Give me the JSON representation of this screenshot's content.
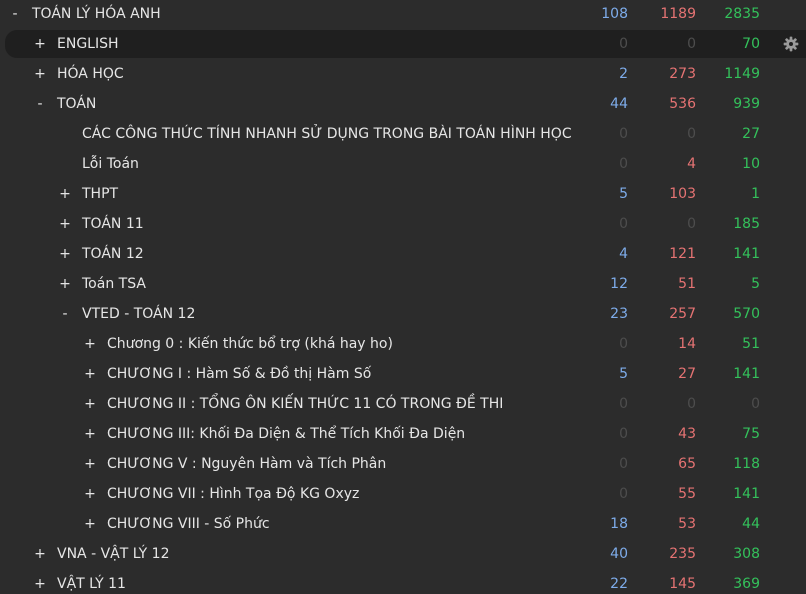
{
  "rows": [
    {
      "toggle": "-",
      "name": "TOÁN LÝ HÓA ANH",
      "new": "108",
      "learn": "1189",
      "due": "2835"
    },
    {
      "toggle": "+",
      "name": "ENGLISH",
      "new": "0",
      "learn": "0",
      "due": "70"
    },
    {
      "toggle": "+",
      "name": "HÓA HỌC",
      "new": "2",
      "learn": "273",
      "due": "1149"
    },
    {
      "toggle": "-",
      "name": "TOÁN",
      "new": "44",
      "learn": "536",
      "due": "939"
    },
    {
      "toggle": "",
      "name": "CÁC CÔNG THỨC TÍNH NHANH SỬ DỤNG TRONG BÀI TOÁN HÌNH HỌC",
      "new": "0",
      "learn": "0",
      "due": "27"
    },
    {
      "toggle": "",
      "name": "Lỗi Toán",
      "new": "0",
      "learn": "4",
      "due": "10"
    },
    {
      "toggle": "+",
      "name": "THPT",
      "new": "5",
      "learn": "103",
      "due": "1"
    },
    {
      "toggle": "+",
      "name": "TOÁN 11",
      "new": "0",
      "learn": "0",
      "due": "185"
    },
    {
      "toggle": "+",
      "name": "TOÁN 12",
      "new": "4",
      "learn": "121",
      "due": "141"
    },
    {
      "toggle": "+",
      "name": "Toán TSA",
      "new": "12",
      "learn": "51",
      "due": "5"
    },
    {
      "toggle": "-",
      "name": "VTED - TOÁN 12",
      "new": "23",
      "learn": "257",
      "due": "570"
    },
    {
      "toggle": "+",
      "name": "Chương 0 : Kiến thức bổ trợ (khá hay ho)",
      "new": "0",
      "learn": "14",
      "due": "51"
    },
    {
      "toggle": "+",
      "name": "CHƯƠNG I : Hàm Số & Đồ thị Hàm Số",
      "new": "5",
      "learn": "27",
      "due": "141"
    },
    {
      "toggle": "+",
      "name": "CHƯƠNG II : TỔNG ÔN KIẾN THỨC 11 CÓ TRONG ĐỀ THI",
      "new": "0",
      "learn": "0",
      "due": "0"
    },
    {
      "toggle": "+",
      "name": "CHƯƠNG III: Khối Đa Diện & Thể Tích Khối Đa Diện",
      "new": "0",
      "learn": "43",
      "due": "75"
    },
    {
      "toggle": "+",
      "name": "CHƯƠNG V : Nguyên Hàm và Tích Phân",
      "new": "0",
      "learn": "65",
      "due": "118"
    },
    {
      "toggle": "+",
      "name": "CHƯƠNG VII : Hình Tọa Độ KG Oxyz",
      "new": "0",
      "learn": "55",
      "due": "141"
    },
    {
      "toggle": "+",
      "name": "CHƯƠNG VIII - Số Phức",
      "new": "18",
      "learn": "53",
      "due": "44"
    },
    {
      "toggle": "+",
      "name": "VNA - VẬT LÝ 12",
      "new": "40",
      "learn": "235",
      "due": "308"
    },
    {
      "toggle": "+",
      "name": "VẬT LÝ 11",
      "new": "22",
      "learn": "145",
      "due": "369"
    }
  ],
  "options_icon": "gear-icon",
  "colors": {
    "new": "#7eacea",
    "learn": "#e57373",
    "due": "#34c15b",
    "zero": "#4d4d4d",
    "text": "#e6e6e6",
    "background": "#2c2c2c",
    "highlight": "#1f1f1f"
  }
}
